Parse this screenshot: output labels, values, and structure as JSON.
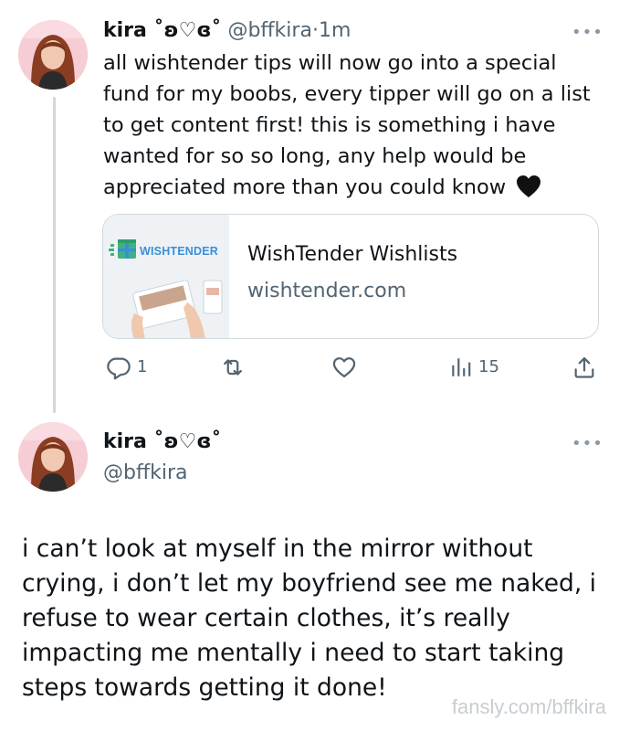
{
  "tweet1": {
    "display_name": "kira ˚ʚ♡ɞ˚",
    "handle": "@bffkira",
    "separator": "·",
    "time": "1m",
    "more": "•••",
    "lines": [
      "all wishtender tips will now go into a special",
      "fund for my boobs, every tipper will go on a list",
      "to get content first! this is something i have",
      "wanted for so so long, any help would be",
      "appreciated more than you could know"
    ],
    "emoji": "black-heart",
    "card": {
      "logo_text": "WISHTENDER",
      "title": "WishTender Wishlists",
      "domain": "wishtender.com"
    },
    "actions": {
      "reply_count": "1",
      "retweet_count": "",
      "like_count": "",
      "views_count": "15"
    }
  },
  "tweet2": {
    "display_name": "kira ˚ʚ♡ɞ˚",
    "handle": "@bffkira",
    "more": "•••",
    "lines": [
      "i can’t look at myself in the mirror without",
      "crying, i don’t let my boyfriend see me naked, i",
      "refuse to wear certain clothes, it’s really",
      "impacting me mentally i need to start taking",
      "steps towards getting it done!"
    ]
  },
  "watermark": "fansly.com/bffkira",
  "colors": {
    "text": "#0f1419",
    "secondary": "#536471",
    "border": "#cfd9de",
    "wishtender_green": "#3fb37f",
    "wishtender_blue": "#3a8fd9"
  }
}
